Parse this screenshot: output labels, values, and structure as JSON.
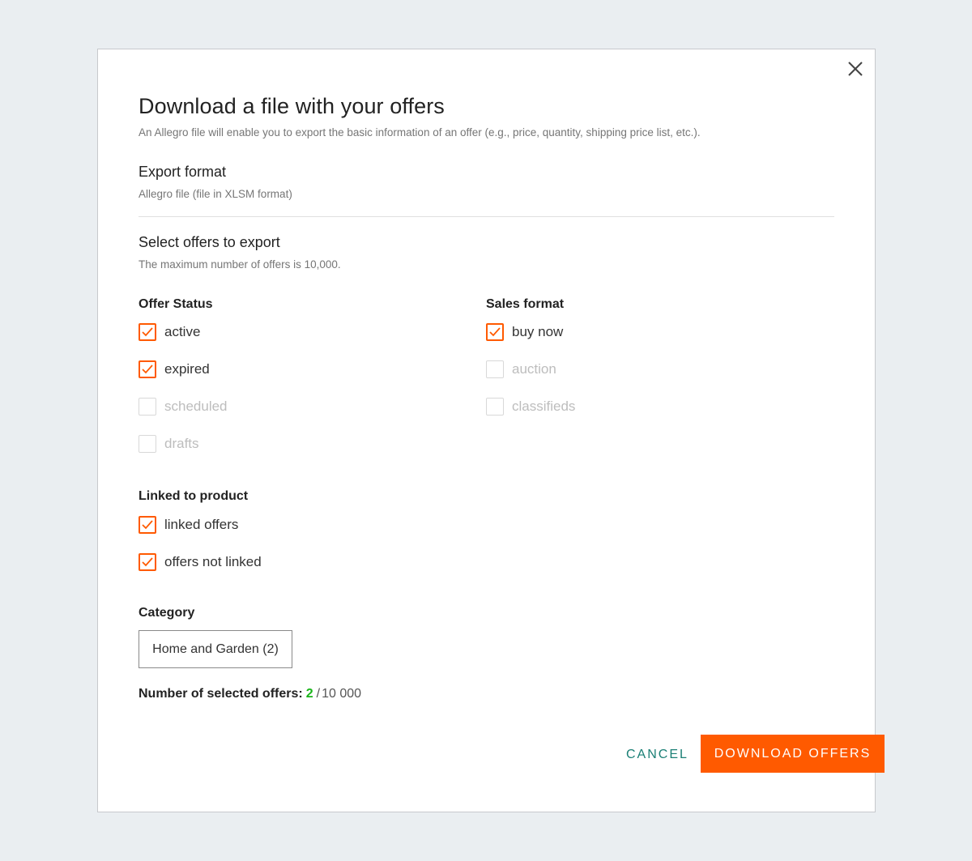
{
  "dialog": {
    "title": "Download a file with your offers",
    "subtitle": "An Allegro file will enable you to export the basic information of an offer (e.g., price, quantity, shipping price list, etc.).",
    "close_icon": "close-icon"
  },
  "export_format": {
    "heading": "Export format",
    "value": "Allegro file (file in XLSM format)"
  },
  "select_offers": {
    "heading": "Select offers to export",
    "note": "The maximum number of offers is 10,000."
  },
  "offer_status": {
    "label": "Offer Status",
    "options": [
      {
        "label": "active",
        "checked": true
      },
      {
        "label": "expired",
        "checked": true
      },
      {
        "label": "scheduled",
        "checked": false
      },
      {
        "label": "drafts",
        "checked": false
      }
    ]
  },
  "sales_format": {
    "label": "Sales format",
    "options": [
      {
        "label": "buy now",
        "checked": true
      },
      {
        "label": "auction",
        "checked": false
      },
      {
        "label": "classifieds",
        "checked": false
      }
    ]
  },
  "linked_to_product": {
    "label": "Linked to product",
    "options": [
      {
        "label": "linked offers",
        "checked": true
      },
      {
        "label": "offers not linked",
        "checked": true
      }
    ]
  },
  "category": {
    "label": "Category",
    "value": "Home and Garden (2)"
  },
  "selected_count": {
    "label": "Number of selected offers:",
    "value": "2",
    "separator": "/",
    "max": "10 000"
  },
  "actions": {
    "cancel_label": "CANCEL",
    "download_label": "DOWNLOAD OFFERS"
  },
  "colors": {
    "accent": "#ff5a00",
    "count_green": "#1ab51a",
    "cancel_teal": "#1a7f75",
    "background": "#eaeef1"
  }
}
